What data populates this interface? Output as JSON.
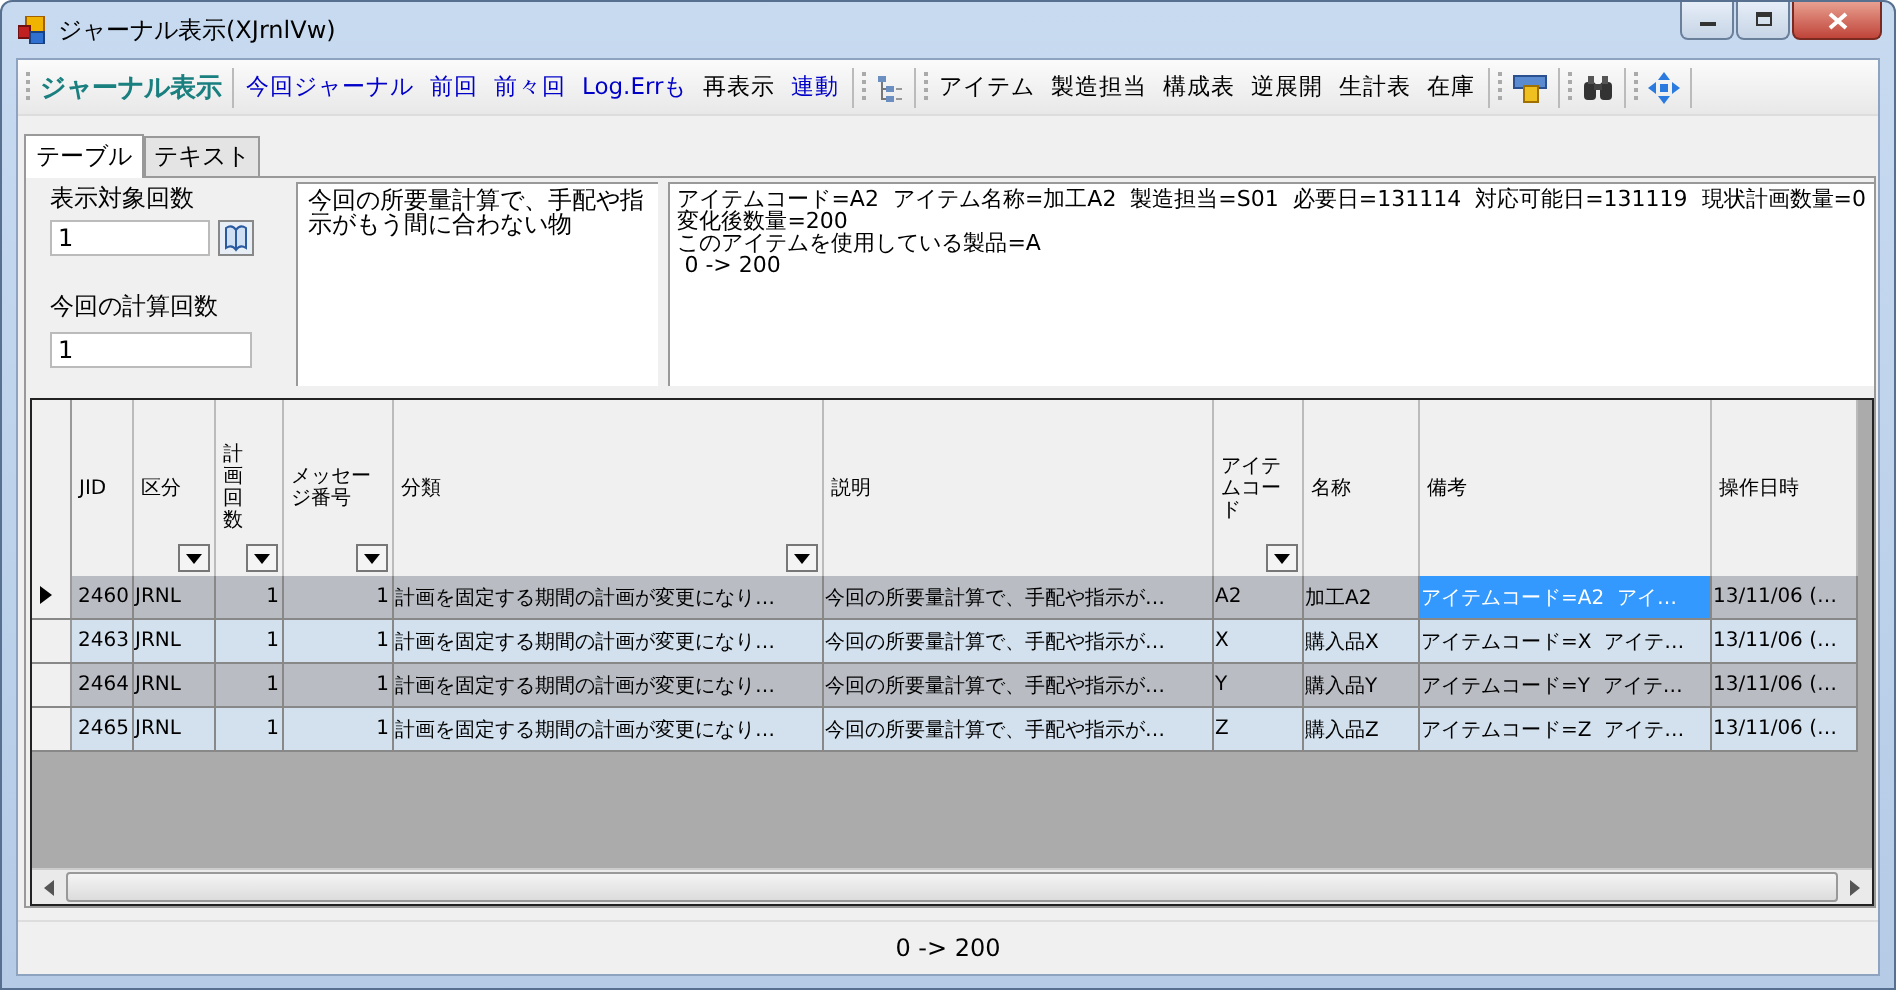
{
  "window": {
    "title": "ジャーナル表示(XJrnlVw)"
  },
  "toolbar": {
    "title": "ジャーナル表示",
    "commands": [
      {
        "label": "今回ジャーナル",
        "kind": "link"
      },
      {
        "label": "前回",
        "kind": "link"
      },
      {
        "label": "前々回",
        "kind": "link"
      },
      {
        "label": "Log.Errも",
        "kind": "link"
      },
      {
        "label": "再表示",
        "kind": "button"
      },
      {
        "label": "連動",
        "kind": "link"
      }
    ],
    "views": [
      "アイテム",
      "製造担当",
      "構成表",
      "逆展開",
      "生計表",
      "在庫"
    ]
  },
  "tabs": [
    {
      "label": "テーブル",
      "selected": true
    },
    {
      "label": "テキスト",
      "selected": false
    }
  ],
  "filters": {
    "display_count_label": "表示対象回数",
    "display_count": "1",
    "current_count_label": "今回の計算回数",
    "current_count": "1"
  },
  "message": "今回の所要量計算で、手配や指示がもう間に合わない物",
  "detail_lines": [
    "アイテムコード=A2  アイテム名称=加工A2  製造担当=S01  必要日=131114  対応可能日=131119  現状計画数量=0",
    "変化後数量=200",
    "このアイテムを使用している製品=A",
    " 0 -> 200"
  ],
  "table": {
    "columns": [
      {
        "label": "JID",
        "filter": false,
        "kind": "number"
      },
      {
        "label": "区分",
        "filter": true,
        "kind": "text"
      },
      {
        "label": "計画回数",
        "filter": true,
        "kind": "number"
      },
      {
        "label": "メッセージ番号",
        "filter": true,
        "kind": "number"
      },
      {
        "label": "分類",
        "filter": true,
        "kind": "text"
      },
      {
        "label": "説明",
        "filter": false,
        "kind": "text"
      },
      {
        "label": "アイテムコード",
        "filter": true,
        "kind": "text"
      },
      {
        "label": "名称",
        "filter": false,
        "kind": "text"
      },
      {
        "label": "備考",
        "filter": false,
        "kind": "text"
      },
      {
        "label": "操作日時",
        "filter": false,
        "kind": "text"
      }
    ],
    "rows": [
      {
        "selected": true,
        "cells": [
          "2460",
          "JRNL",
          "1",
          "1",
          "計画を固定する期間の計画が変更になり…",
          "今回の所要量計算で、手配や指示が…",
          "A2",
          "加工A2",
          "アイテムコード=A2  アイ…",
          "13/11/06 (…"
        ],
        "cell_selected": [
          false,
          false,
          false,
          false,
          false,
          false,
          false,
          false,
          true,
          false
        ]
      },
      {
        "selected": false,
        "cells": [
          "2463",
          "JRNL",
          "1",
          "1",
          "計画を固定する期間の計画が変更になり…",
          "今回の所要量計算で、手配や指示が…",
          "X",
          "購入品X",
          "アイテムコード=X  アイテ…",
          "13/11/06 (…"
        ]
      },
      {
        "selected": false,
        "cells": [
          "2464",
          "JRNL",
          "1",
          "1",
          "計画を固定する期間の計画が変更になり…",
          "今回の所要量計算で、手配や指示が…",
          "Y",
          "購入品Y",
          "アイテムコード=Y  アイテ…",
          "13/11/06 (…"
        ]
      },
      {
        "selected": false,
        "cells": [
          "2465",
          "JRNL",
          "1",
          "1",
          "計画を固定する期間の計画が変更になり…",
          "今回の所要量計算で、手配や指示が…",
          "Z",
          "購入品Z",
          "アイテムコード=Z  アイテ…",
          "13/11/06 (…"
        ]
      }
    ]
  },
  "status_bar": {
    "text": "0 -> 200"
  }
}
